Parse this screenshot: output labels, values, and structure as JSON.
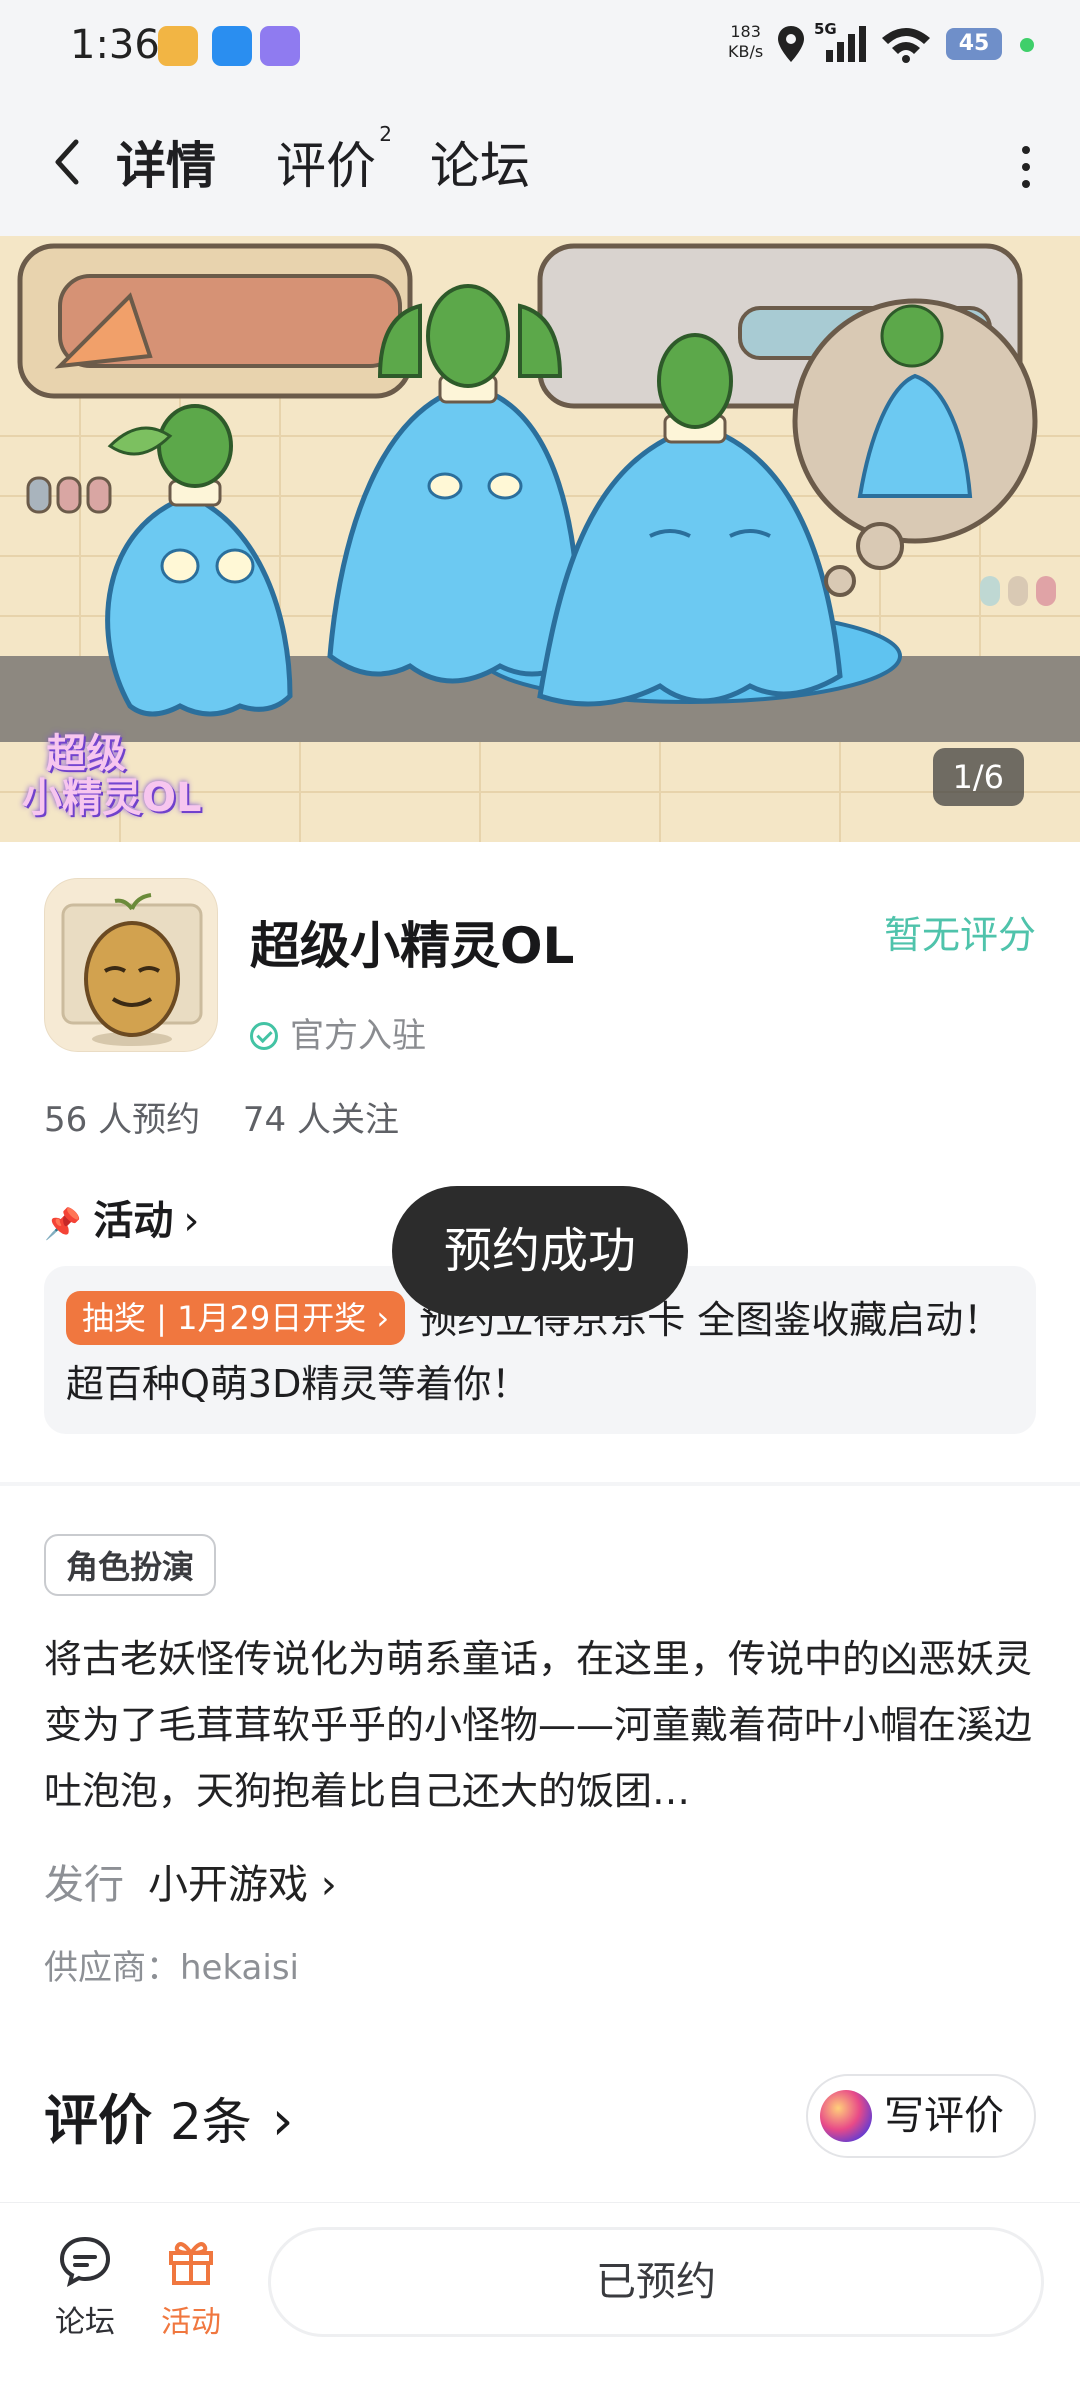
{
  "status_bar": {
    "time": "1:36",
    "net_speed_value": "183",
    "net_speed_unit": "KB/s",
    "network": "5G",
    "battery": "45"
  },
  "header": {
    "tabs": [
      {
        "label": "详情",
        "active": true
      },
      {
        "label": "评价",
        "badge": "2"
      },
      {
        "label": "论坛"
      }
    ]
  },
  "banner": {
    "counter": "1/6",
    "logo_line1": "超级",
    "logo_line2": "小精灵OL"
  },
  "game": {
    "name": "超级小精灵OL",
    "official_label": "官方入驻",
    "rating": "暂无评分",
    "reservations": "56 人预约",
    "followers": "74 人关注"
  },
  "activity": {
    "title": "活动",
    "tag": "抽奖 | 1月29日开奖 ›",
    "text": "预约立得京东卡 全图鉴收藏启动！超百种Q萌3D精灵等着你！"
  },
  "toast": "预约成功",
  "info": {
    "genre": "角色扮演",
    "description": "将古老妖怪传说化为萌系童话，在这里，传说中的凶恶妖灵变为了毛茸茸软乎乎的小怪物——河童戴着荷叶小帽在溪边吐泡泡，天狗抱着比自己还大的饭团…",
    "publisher_label": "发行",
    "publisher": "小开游戏",
    "supplier": "供应商：hekaisi"
  },
  "reviews": {
    "title": "评价",
    "count": "2条",
    "write_label": "写评价"
  },
  "bottom_bar": {
    "forum_label": "论坛",
    "activity_label": "活动",
    "reserved_label": "已预约"
  },
  "colors": {
    "accent_green": "#4fc3ab",
    "accent_orange": "#f0773f"
  }
}
